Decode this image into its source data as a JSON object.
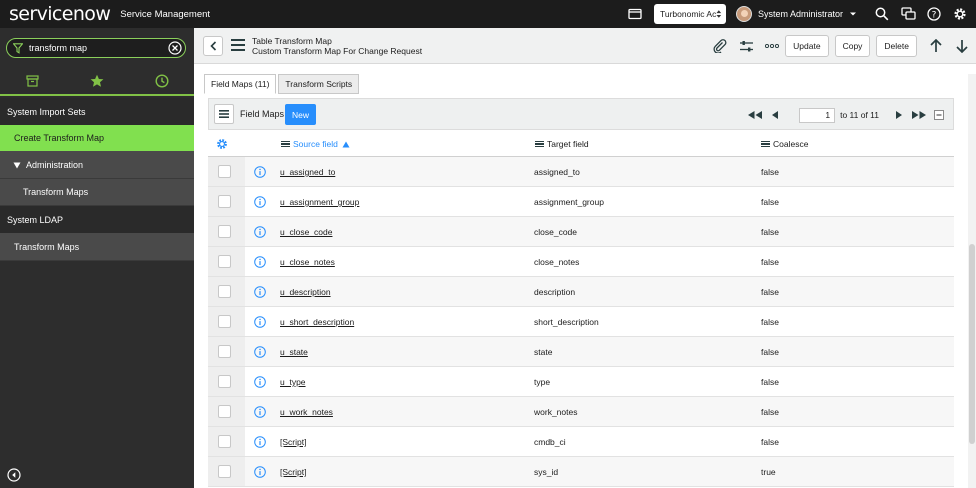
{
  "header": {
    "logo_text": "servicenow",
    "product": "Service Management",
    "scope": "Turbonomic Ac",
    "user_name": "System Administrator"
  },
  "sidebar": {
    "filter_value": "transform map",
    "items": [
      {
        "label": "System Import Sets"
      },
      {
        "label": "Create Transform Map"
      },
      {
        "label": "Administration"
      },
      {
        "label": "Transform Maps"
      },
      {
        "label": "System LDAP"
      },
      {
        "label": "Transform Maps"
      }
    ]
  },
  "form": {
    "table": "Table Transform Map",
    "record": "Custom Transform Map For Change Request",
    "buttons": {
      "update": "Update",
      "copy": "Copy",
      "delete": "Delete"
    }
  },
  "tabs": [
    "Field Maps (11)",
    "Transform Scripts"
  ],
  "list": {
    "title": "Field Maps",
    "new_label": "New",
    "page_value": "1",
    "page_of": "to 11 of 11",
    "columns": {
      "source": "Source field",
      "target": "Target field",
      "coalesce": "Coalesce"
    },
    "rows": [
      {
        "source": "u_assigned_to",
        "target": "assigned_to",
        "coalesce": "false"
      },
      {
        "source": "u_assignment_group",
        "target": "assignment_group",
        "coalesce": "false"
      },
      {
        "source": "u_close_code",
        "target": "close_code",
        "coalesce": "false"
      },
      {
        "source": "u_close_notes",
        "target": "close_notes",
        "coalesce": "false"
      },
      {
        "source": "u_description",
        "target": "description",
        "coalesce": "false"
      },
      {
        "source": "u_short_description",
        "target": "short_description",
        "coalesce": "false"
      },
      {
        "source": "u_state",
        "target": "state",
        "coalesce": "false"
      },
      {
        "source": "u_type",
        "target": "type",
        "coalesce": "false"
      },
      {
        "source": "u_work_notes",
        "target": "work_notes",
        "coalesce": "false"
      },
      {
        "source": "[Script]",
        "target": "cmdb_ci",
        "coalesce": "false"
      },
      {
        "source": "[Script]",
        "target": "sys_id",
        "coalesce": "true"
      }
    ]
  },
  "colors": {
    "accent_green": "#81e04f",
    "primary_blue": "#278efc",
    "header_dark": "#1c1c1c"
  }
}
